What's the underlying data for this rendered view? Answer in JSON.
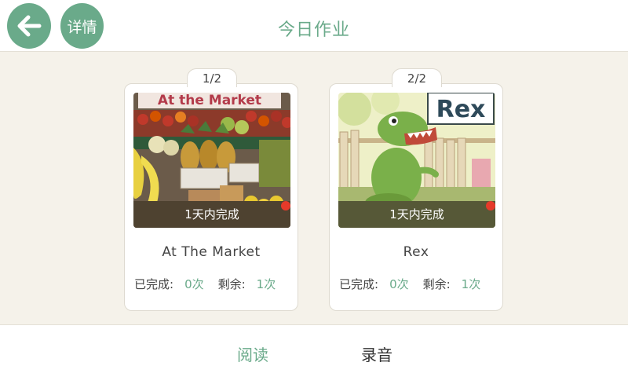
{
  "header": {
    "title": "今日作业",
    "detail_label": "详情",
    "back_icon": "arrow-left-icon"
  },
  "colors": {
    "accent": "#6aaa8a",
    "background": "#f5f2ea",
    "dot": "#e53a2a"
  },
  "books": [
    {
      "page": "1/2",
      "cover_text": "At the Market",
      "due": "1天内完成",
      "title": "At The Market",
      "done_label": "已完成:",
      "done_value": "0次",
      "remaining_label": "剩余:",
      "remaining_value": "1次"
    },
    {
      "page": "2/2",
      "cover_text": "Rex",
      "due": "1天内完成",
      "title": "Rex",
      "done_label": "已完成:",
      "done_value": "0次",
      "remaining_label": "剩余:",
      "remaining_value": "1次"
    }
  ],
  "tabs": {
    "read": "阅读",
    "record": "录音"
  }
}
